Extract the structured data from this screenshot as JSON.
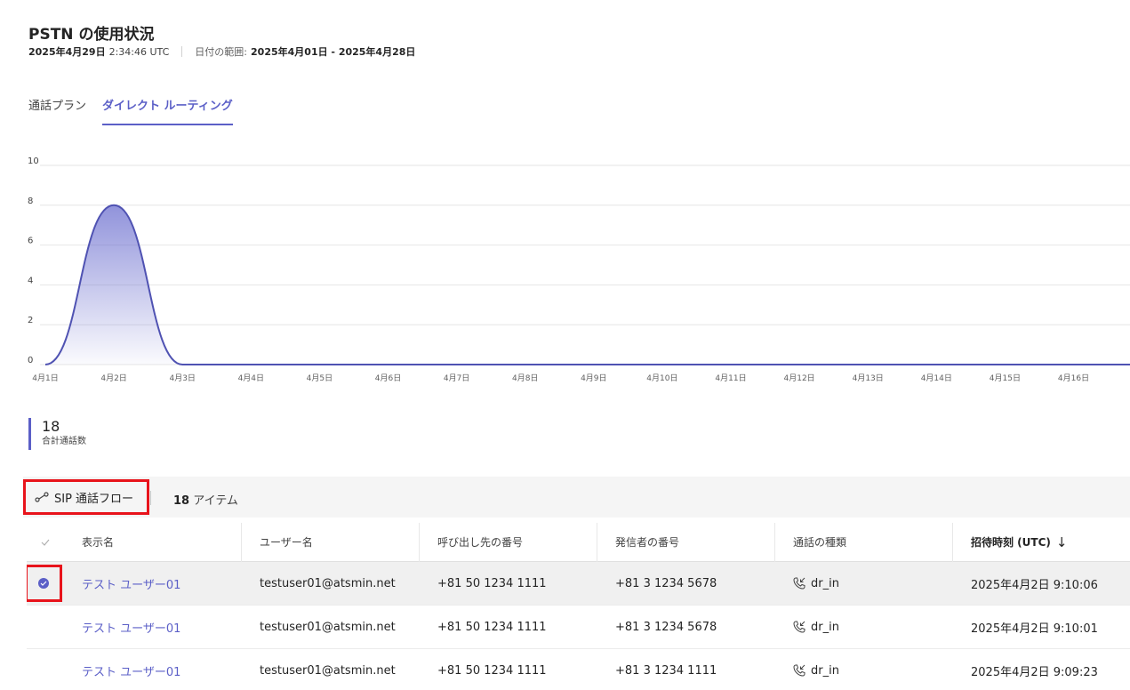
{
  "header": {
    "title": "PSTN の使用状況",
    "date": "2025年4月29日",
    "time": "2:34:46 UTC",
    "range_label": "日付の範囲:",
    "range_value": "2025年4月01日 - 2025年4月28日"
  },
  "tabs": [
    {
      "label": "通話プラン",
      "active": false
    },
    {
      "label": "ダイレクト ルーティング",
      "active": true
    }
  ],
  "chart_data": {
    "type": "area",
    "x": [
      "4月1日",
      "4月2日",
      "4月3日",
      "4月4日",
      "4月5日",
      "4月6日",
      "4月7日",
      "4月8日",
      "4月9日",
      "4月10日",
      "4月11日",
      "4月12日",
      "4月13日",
      "4月14日",
      "4月15日",
      "4月16日"
    ],
    "values": [
      0,
      8,
      0,
      0,
      0,
      0,
      0,
      0,
      0,
      0,
      0,
      0,
      0,
      0,
      0,
      0
    ],
    "yticks": [
      "0",
      "2",
      "4",
      "6",
      "8",
      "10"
    ],
    "ylim": [
      0,
      10
    ],
    "grid": true,
    "color": "#4f52b2"
  },
  "kpi": {
    "value": "18",
    "label": "合計通話数"
  },
  "toolbar": {
    "sip_label": "SIP 通話フロー",
    "item_count": "18",
    "item_label": "アイテム"
  },
  "table": {
    "columns": [
      "表示名",
      "ユーザー名",
      "呼び出し先の番号",
      "発信者の番号",
      "通話の種類",
      "招待時刻 (UTC)"
    ],
    "sort_icon": "↓",
    "rows": [
      {
        "name": "テスト ユーザー01",
        "user": "testuser01@atsmin.net",
        "called": "+81 50 1234 1111",
        "caller": "+81 3 1234 5678",
        "type": "dr_in",
        "time": "2025年4月2日 9:10:06"
      },
      {
        "name": "テスト ユーザー01",
        "user": "testuser01@atsmin.net",
        "called": "+81 50 1234 1111",
        "caller": "+81 3 1234 5678",
        "type": "dr_in",
        "time": "2025年4月2日 9:10:01"
      },
      {
        "name": "テスト ユーザー01",
        "user": "testuser01@atsmin.net",
        "called": "+81 50 1234 1111",
        "caller": "+81 3 1234 1111",
        "type": "dr_in",
        "time": "2025年4月2日 9:09:23"
      }
    ]
  }
}
